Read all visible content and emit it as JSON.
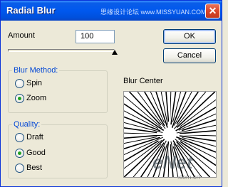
{
  "window": {
    "title": "Radial Blur",
    "close_glyph": "✕"
  },
  "watermark": {
    "top": "思缘设计论坛 www.MISSYUAN.COM",
    "brand": "eNet",
    "domain": ".com.cn"
  },
  "amount": {
    "label": "Amount",
    "value": "100",
    "slider_fraction": 1.0
  },
  "blur_method": {
    "title": "Blur Method:",
    "options": [
      {
        "label": "Spin",
        "checked": false
      },
      {
        "label": "Zoom",
        "checked": true
      }
    ]
  },
  "quality": {
    "title": "Quality:",
    "options": [
      {
        "label": "Draft",
        "checked": false
      },
      {
        "label": "Good",
        "checked": true
      },
      {
        "label": "Best",
        "checked": false
      }
    ]
  },
  "buttons": {
    "ok": "OK",
    "cancel": "Cancel"
  },
  "preview": {
    "label": "Blur Center"
  },
  "colors": {
    "title_bar": "#0058ee",
    "group_title": "#0046d5",
    "dialog_bg": "#ece9d8"
  }
}
